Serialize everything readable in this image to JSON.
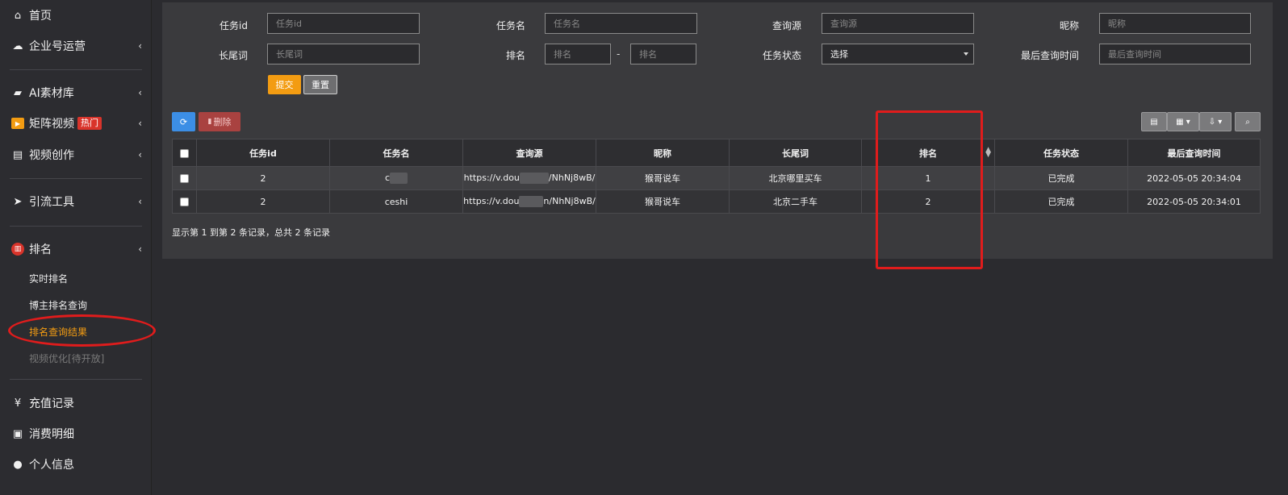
{
  "sidebar": {
    "items": [
      {
        "label": "首页",
        "icon": "home-icon"
      },
      {
        "label": "企业号运营",
        "icon": "cloud-icon"
      },
      {
        "label": "AI素材库",
        "icon": "folder-icon"
      },
      {
        "label": "矩阵视频",
        "icon": "video-icon",
        "badge": "热门"
      },
      {
        "label": "视频创作",
        "icon": "film-icon"
      },
      {
        "label": "引流工具",
        "icon": "send-icon"
      },
      {
        "label": "排名",
        "icon": "chart-icon"
      },
      {
        "label": "充值记录",
        "icon": "yen-icon"
      },
      {
        "label": "消费明细",
        "icon": "money-icon"
      },
      {
        "label": "个人信息",
        "icon": "user-icon"
      }
    ],
    "ranking_sub": [
      {
        "label": "实时排名"
      },
      {
        "label": "博主排名查询"
      },
      {
        "label": "排名查询结果"
      },
      {
        "label": "视频优化[待开放]"
      }
    ]
  },
  "filters": {
    "task_id": {
      "label": "任务id",
      "placeholder": "任务id"
    },
    "task_name": {
      "label": "任务名",
      "placeholder": "任务名"
    },
    "query_source": {
      "label": "查询源",
      "placeholder": "查询源"
    },
    "nickname": {
      "label": "昵称",
      "placeholder": "昵称"
    },
    "long_tail": {
      "label": "长尾词",
      "placeholder": "长尾词"
    },
    "rank": {
      "label": "排名",
      "placeholder_from": "排名",
      "placeholder_to": "排名",
      "separator": "-"
    },
    "task_status": {
      "label": "任务状态",
      "value": "选择"
    },
    "last_query_time": {
      "label": "最后查询时间",
      "placeholder": "最后查询时间"
    },
    "submit_label": "提交",
    "reset_label": "重置"
  },
  "toolbar": {
    "delete_label": "删除"
  },
  "table": {
    "headers": [
      "任务id",
      "任务名",
      "查询源",
      "昵称",
      "长尾词",
      "排名",
      "任务状态",
      "最后查询时间"
    ],
    "rows": [
      {
        "id": "2",
        "name_prefix": "c",
        "source_prefix": "https://v.dou",
        "source_suffix": "/NhNj8wB/",
        "nickname": "猴哥说车",
        "keyword": "北京哪里买车",
        "rank": "1",
        "status": "已完成",
        "time": "2022-05-05 20:34:04"
      },
      {
        "id": "2",
        "name": "ceshi",
        "source_prefix": "https://v.dou",
        "source_suffix": "n/NhNj8wB/",
        "nickname": "猴哥说车",
        "keyword": "北京二手车",
        "rank": "2",
        "status": "已完成",
        "time": "2022-05-05 20:34:01"
      }
    ]
  },
  "pagination_text": "显示第 1 到第 2 条记录，总共 2 条记录",
  "colors": {
    "accent_orange": "#f39c12",
    "primary_blue": "#3c8ee5",
    "danger_red": "#a94240",
    "annotation_red": "#e01c1c"
  }
}
